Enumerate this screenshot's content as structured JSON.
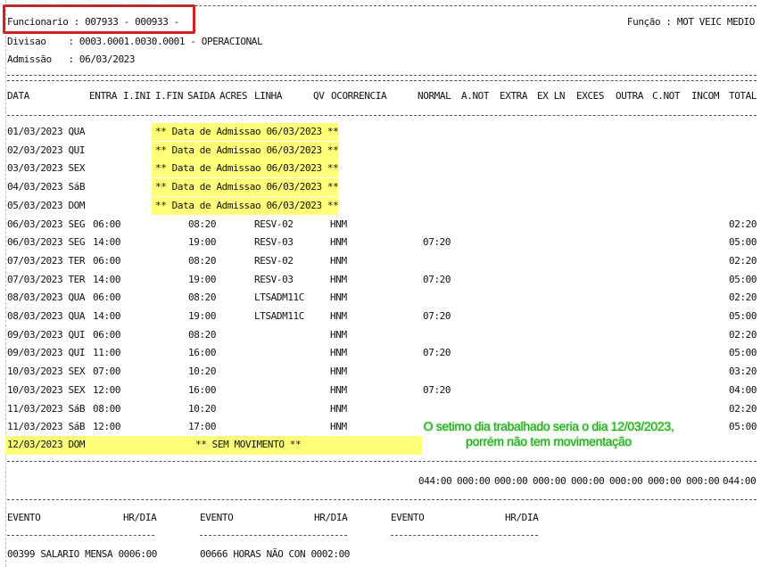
{
  "header": {
    "funcionario": "Funcionario : 007933 - 000933 -",
    "funcao": "Função : MOT VEIC MEDIO",
    "divisao": "Divisao    : 0003.0001.0030.0001 - OPERACIONAL",
    "admissao": "Admissão   : 06/03/2023"
  },
  "columns": [
    "DATA",
    "ENTRA",
    "I.INI",
    "I.FIN",
    "SAIDA",
    "ACRES",
    "LINHA",
    "QV",
    "OCORRENCIA",
    "NORMAL",
    "A.NOT",
    "EXTRA",
    "EX LN",
    "EXCES",
    "OUTRA",
    "C.NOT",
    "INCOM",
    "TOTAL"
  ],
  "rows": [
    {
      "date": "01/03/2023 QUA",
      "message": "** Data de Admissao 06/03/2023 **"
    },
    {
      "date": "02/03/2023 QUI",
      "message": "** Data de Admissao 06/03/2023 **"
    },
    {
      "date": "03/03/2023 SEX",
      "message": "** Data de Admissao 06/03/2023 **"
    },
    {
      "date": "04/03/2023 SáB",
      "message": "** Data de Admissao 06/03/2023 **"
    },
    {
      "date": "05/03/2023 DOM",
      "message": "** Data de Admissao 06/03/2023 **"
    },
    {
      "date": "06/03/2023 SEG",
      "entra": "06:00",
      "saida": "08:20",
      "linha": "RESV-02",
      "ocorrencia": "HNM",
      "normal": "",
      "total": "02:20"
    },
    {
      "date": "06/03/2023 SEG",
      "entra": "14:00",
      "saida": "19:00",
      "linha": "RESV-03",
      "ocorrencia": "HNM",
      "normal": "07:20",
      "total": "05:00"
    },
    {
      "date": "07/03/2023 TER",
      "entra": "06:00",
      "saida": "08:20",
      "linha": "RESV-02",
      "ocorrencia": "HNM",
      "normal": "",
      "total": "02:20"
    },
    {
      "date": "07/03/2023 TER",
      "entra": "14:00",
      "saida": "19:00",
      "linha": "RESV-03",
      "ocorrencia": "HNM",
      "normal": "07:20",
      "total": "05:00"
    },
    {
      "date": "08/03/2023 QUA",
      "entra": "06:00",
      "saida": "08:20",
      "linha": "LTSADM11C",
      "ocorrencia": "HNM",
      "normal": "",
      "total": "02:20"
    },
    {
      "date": "08/03/2023 QUA",
      "entra": "14:00",
      "saida": "19:00",
      "linha": "LTSADM11C",
      "ocorrencia": "HNM",
      "normal": "07:20",
      "total": "05:00"
    },
    {
      "date": "09/03/2023 QUI",
      "entra": "06:00",
      "saida": "08:20",
      "linha": "",
      "ocorrencia": "HNM",
      "normal": "",
      "total": "02:20"
    },
    {
      "date": "09/03/2023 QUI",
      "entra": "11:00",
      "saida": "16:00",
      "linha": "",
      "ocorrencia": "HNM",
      "normal": "07:20",
      "total": "05:00"
    },
    {
      "date": "10/03/2023 SEX",
      "entra": "07:00",
      "saida": "10:20",
      "linha": "",
      "ocorrencia": "HNM",
      "normal": "",
      "total": "03:20"
    },
    {
      "date": "10/03/2023 SEX",
      "entra": "12:00",
      "saida": "16:00",
      "linha": "",
      "ocorrencia": "HNM",
      "normal": "07:20",
      "total": "04:00"
    },
    {
      "date": "11/03/2023 SáB",
      "entra": "08:00",
      "saida": "10:20",
      "linha": "",
      "ocorrencia": "HNM",
      "normal": "",
      "total": "02:20"
    },
    {
      "date": "11/03/2023 SáB",
      "entra": "12:00",
      "saida": "17:00",
      "linha": "",
      "ocorrencia": "HNM",
      "normal": "",
      "total": "05:00"
    }
  ],
  "last_row": {
    "date": "12/03/2023 DOM",
    "message": "** SEM MOVIMENTO **"
  },
  "annotation": {
    "line1": "O setimo dia trabalhado seria o dia 12/03/2023,",
    "line2": "porrém não tem movimentação"
  },
  "totals": [
    "044:00",
    "000:00",
    "000:00",
    "000:00",
    "000:00",
    "000:00",
    "000:00",
    "000:00",
    "044:00"
  ],
  "events_header": [
    {
      "evento": "EVENTO",
      "hr": "HR/DIA"
    },
    {
      "evento": "EVENTO",
      "hr": "HR/DIA"
    },
    {
      "evento": "EVENTO",
      "hr": "HR/DIA"
    }
  ],
  "events": [
    "00399 SALARIO MENSA 0006:00",
    "00666 HORAS NÃO CON 0002:00"
  ],
  "colors": {
    "highlight": "#ffff7a",
    "annotation": "#1c9a2a",
    "redbox": "#d21f1f"
  }
}
